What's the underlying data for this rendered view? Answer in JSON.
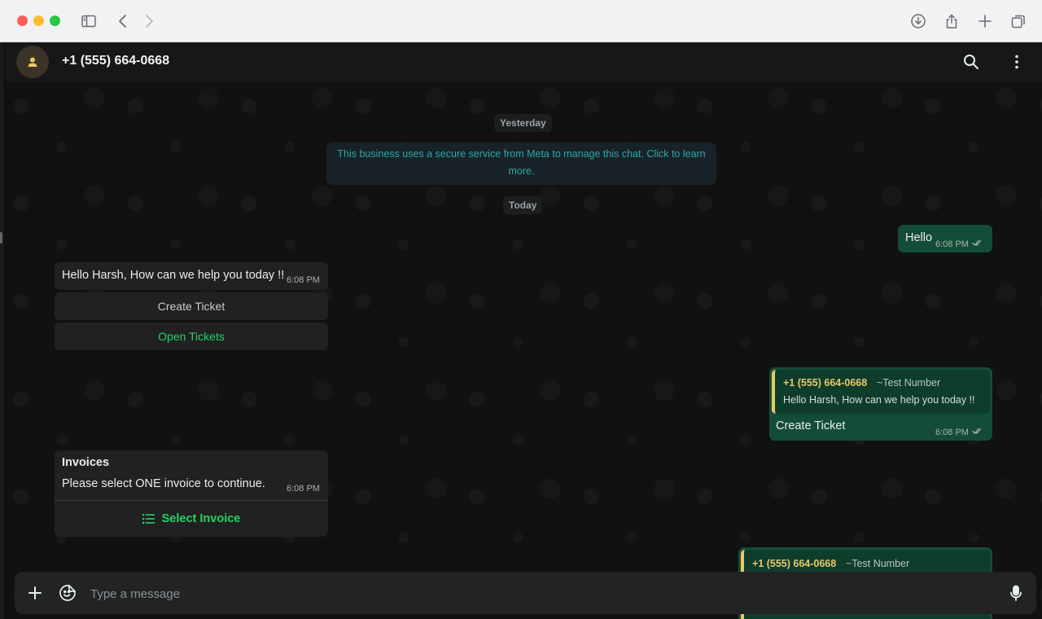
{
  "header": {
    "contact_name": "+1 (555) 664-0668"
  },
  "chat": {
    "date_yesterday": "Yesterday",
    "system_message": "This business uses a secure service from Meta to manage this chat. Click to learn more.",
    "date_today": "Today",
    "msg_hello": {
      "text": "Hello",
      "time": "6:08 PM"
    },
    "msg_greeting": {
      "text": "Hello Harsh, How can we help you today !!",
      "time": "6:08 PM",
      "buttons": [
        "Create Ticket",
        "Open Tickets"
      ]
    },
    "msg_reply_create": {
      "quote_name": "+1 (555) 664-0668",
      "quote_sub": "~Test Number",
      "quote_text": "Hello Harsh, How can we help you today !!",
      "text": "Create Ticket",
      "time": "6:08 PM"
    },
    "msg_invoices": {
      "title": "Invoices",
      "text": "Please select ONE invoice to continue.",
      "time": "6:08 PM",
      "action": "Select Invoice"
    },
    "msg_reply_partial": {
      "quote_name": "+1 (555) 664-0668",
      "quote_sub": "~Test Number"
    }
  },
  "footer": {
    "placeholder": "Type a message"
  },
  "colors": {
    "accent_green": "#25d366",
    "outgoing_bubble": "#144d37",
    "quote_name": "#e8c76a"
  }
}
